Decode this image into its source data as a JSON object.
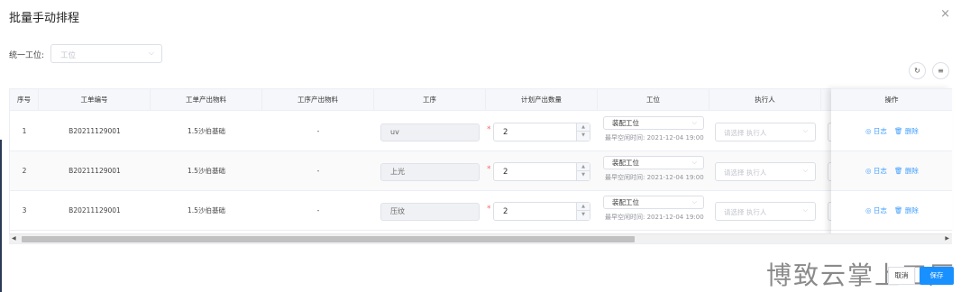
{
  "modal": {
    "title": "批量手动排程",
    "close_glyph": "×"
  },
  "unify": {
    "label": "统一工位:",
    "placeholder": "工位",
    "chevron": "⌵"
  },
  "toolbar": {
    "refresh_glyph": "↻",
    "columns_glyph": "≡"
  },
  "table": {
    "headers": {
      "index": "序号",
      "order_no": "工单编号",
      "order_output": "工单产出物料",
      "process_output": "工序产出物料",
      "process": "工序",
      "planned_qty": "计划产出数量",
      "station": "工位",
      "executor": "执行人",
      "operation": "操作"
    },
    "rows": [
      {
        "index": "1",
        "order_no": "B20211129001",
        "order_output": "1.5沙伯基础",
        "process_output": "-",
        "process": "uv",
        "qty": "2",
        "station": "装配工位",
        "free_time": "最早空闲时间: 2021-12-04 19:00",
        "executor_placeholder": "请选择 执行人"
      },
      {
        "index": "2",
        "order_no": "B20211129001",
        "order_output": "1.5沙伯基础",
        "process_output": "-",
        "process": "上光",
        "qty": "2",
        "station": "装配工位",
        "free_time": "最早空闲时间: 2021-12-04 19:00",
        "executor_placeholder": "请选择 执行人"
      },
      {
        "index": "3",
        "order_no": "B20211129001",
        "order_output": "1.5沙伯基础",
        "process_output": "-",
        "process": "压纹",
        "qty": "2",
        "station": "装配工位",
        "free_time": "最早空闲时间: 2021-12-04 19:00",
        "executor_placeholder": "请选择 执行人"
      }
    ],
    "required_mark": "*",
    "up_glyph": "▲",
    "down_glyph": "▼",
    "select_chevron": "⌵"
  },
  "operations": {
    "log_label": "◎ 日志",
    "delete_label": "🗑 删除"
  },
  "scrollbar": {
    "left_arrow": "◀",
    "right_arrow": "▶"
  },
  "watermark": "博致云掌上工厂",
  "footer": {
    "cancel_label": "取消",
    "save_label": "保存"
  }
}
